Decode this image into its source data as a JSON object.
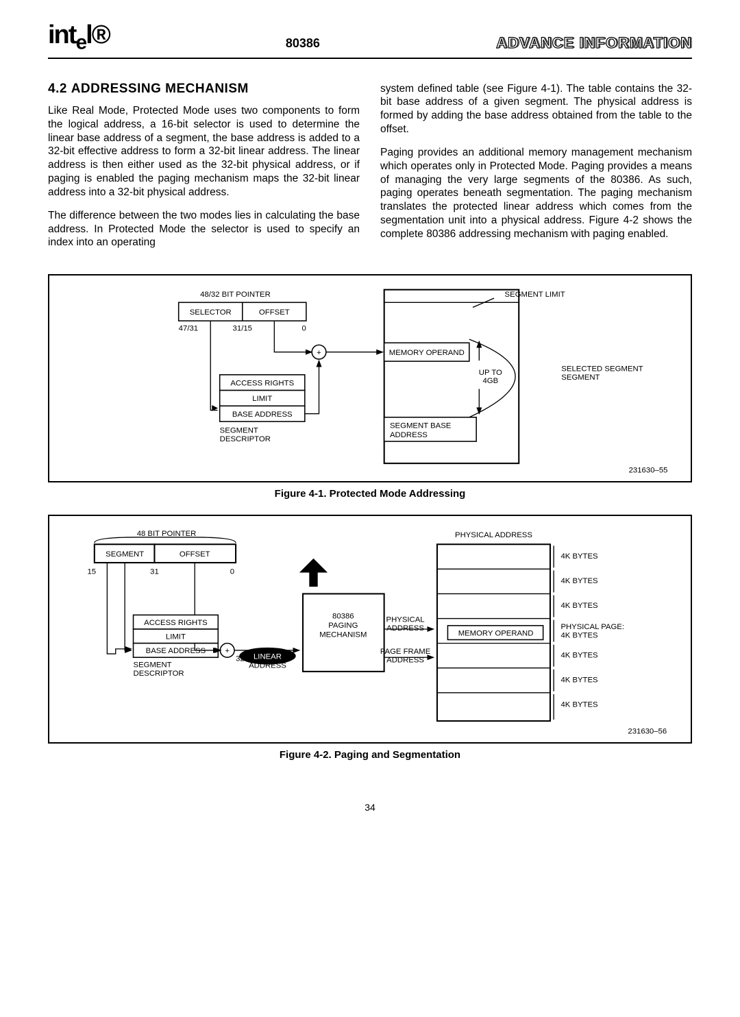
{
  "header": {
    "logo": "intel",
    "chip": "80386",
    "advance": "ADVANCE INFORMATION"
  },
  "section": {
    "num": "4.2",
    "title": "ADDRESSING MECHANISM"
  },
  "p1": "Like Real Mode, Protected Mode uses two components to form the logical address, a 16-bit selector is used to determine the linear base address of a segment, the base address is added to a 32-bit effective address to form a 32-bit linear address. The linear address is then either used as the 32-bit physical address, or if paging is enabled the paging mechanism maps the 32-bit linear address into a 32-bit physical address.",
  "p2": "The difference between the two modes lies in calculating the base address. In Protected Mode the selector is used to specify an index into an operating",
  "p3": "system defined table (see Figure 4-1). The table contains the 32-bit base address of a given segment. The physical address is formed by adding the base address obtained from the table to the offset.",
  "p4": "Paging provides an additional memory management mechanism which operates only in Protected Mode. Paging provides a means of managing the very large segments of the 80386. As such, paging operates beneath segmentation. The paging mechanism translates the protected linear address which comes from the segmentation unit into a physical address. Figure 4-2 shows the complete 80386 addressing mechanism with paging enabled.",
  "fig1": {
    "title": "48/32 BIT POINTER",
    "selector": "SELECTOR",
    "offset": "OFFSET",
    "b47": "47/31",
    "b31": "31/15",
    "b0": "0",
    "ar": "ACCESS RIGHTS",
    "lim": "LIMIT",
    "base": "BASE ADDRESS",
    "segdesc": "SEGMENT\nDESCRIPTOR",
    "mem": "MEMORY OPERAND",
    "seglimit": "SEGMENT LIMIT",
    "upto": "UP TO\n4GB",
    "selseg": "SELECTED\nSEGMENT",
    "segbase": "SEGMENT BASE\nADDRESS",
    "id": "231630–55",
    "caption": "Figure 4-1. Protected Mode Addressing"
  },
  "fig2": {
    "title": "48 BIT POINTER",
    "segment": "SEGMENT",
    "offset": "OFFSET",
    "b15": "15",
    "b31": "31",
    "b0": "0",
    "ar": "ACCESS RIGHTS",
    "lim": "LIMIT",
    "base": "BASE ADDRESS",
    "segdesc": "SEGMENT\nDESCRIPTOR",
    "b32": "32",
    "linaddr": "LINEAR\nADDRESS",
    "paging": "80386\nPAGING\nMECHANISM",
    "pfa": "PHYSICAL\nADDRESS",
    "pf": "PAGE FRAME\nADDRESS",
    "mem": "MEMORY OPERAND",
    "pa_head": "PHYSICAL ADDRESS",
    "kb": "4K BYTES",
    "pp": "PHYSICAL PAGE:\n4K BYTES",
    "id": "231630–56",
    "caption": "Figure 4-2. Paging and Segmentation"
  },
  "page": "34"
}
